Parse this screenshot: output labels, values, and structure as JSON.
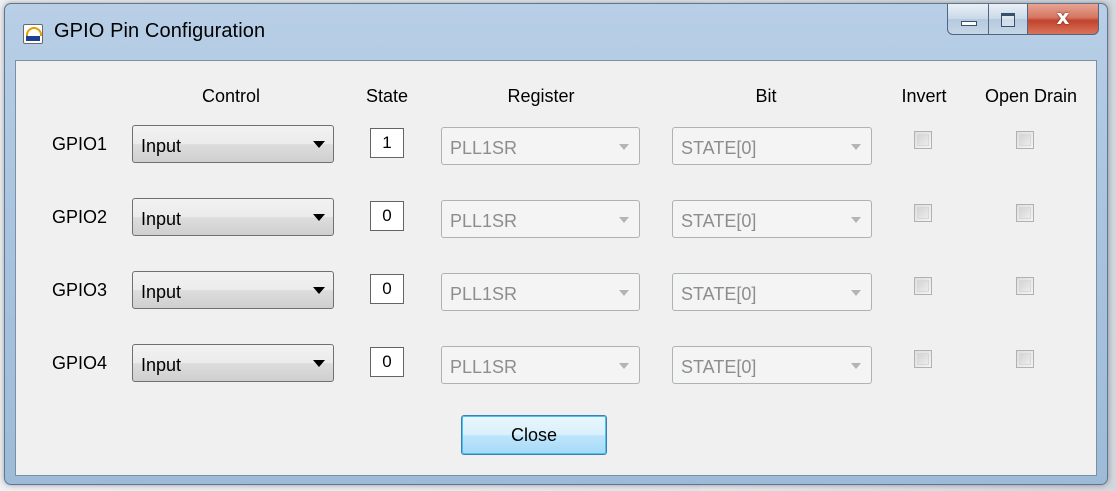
{
  "window": {
    "title": "GPIO Pin Configuration",
    "close_glyph": "x"
  },
  "headers": {
    "control": "Control",
    "state": "State",
    "register": "Register",
    "bit": "Bit",
    "invert": "Invert",
    "open_drain": "Open Drain"
  },
  "rows": [
    {
      "label": "GPIO1",
      "control": "Input",
      "state": "1",
      "register": "PLL1SR",
      "bit": "STATE[0]",
      "invert": false,
      "open_drain": false
    },
    {
      "label": "GPIO2",
      "control": "Input",
      "state": "0",
      "register": "PLL1SR",
      "bit": "STATE[0]",
      "invert": false,
      "open_drain": false
    },
    {
      "label": "GPIO3",
      "control": "Input",
      "state": "0",
      "register": "PLL1SR",
      "bit": "STATE[0]",
      "invert": false,
      "open_drain": false
    },
    {
      "label": "GPIO4",
      "control": "Input",
      "state": "0",
      "register": "PLL1SR",
      "bit": "STATE[0]",
      "invert": false,
      "open_drain": false
    }
  ],
  "close_button": "Close",
  "icons": {
    "app": "app-logo-icon",
    "minimize": "minimize-icon",
    "maximize": "maximize-icon",
    "close": "close-icon",
    "dropdown": "chevron-down-icon"
  },
  "colors": {
    "title_bar": "#a9c4df",
    "client_bg": "#f0f0f0",
    "close_caption": "#c2432c",
    "focused_button_border": "#3c7fb1",
    "disabled_text": "#8d8d8d"
  }
}
